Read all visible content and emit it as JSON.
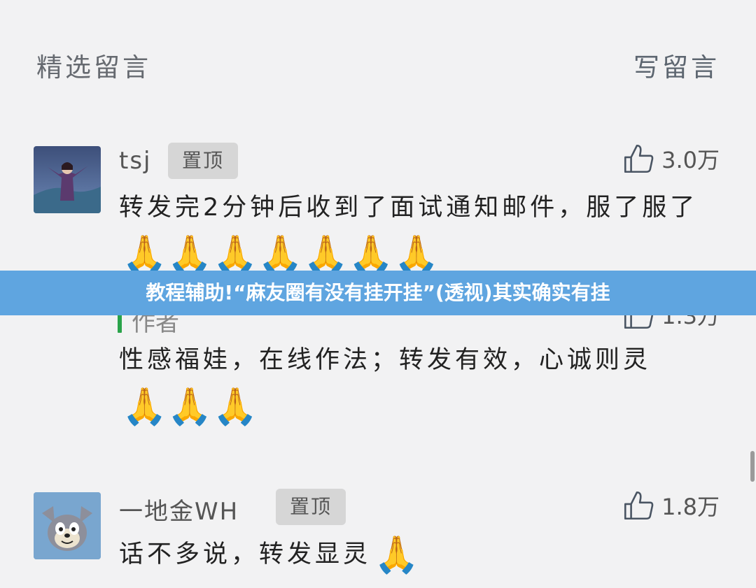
{
  "header": {
    "title": "精选留言",
    "write_label": "写留言"
  },
  "comments": [
    {
      "author": "tsj",
      "pin": "置顶",
      "likes": "3.0万",
      "text": "转发完2分钟后收到了面试通知邮件，服了服了",
      "emoji": "🙏🙏🙏🙏🙏🙏🙏"
    },
    {
      "author": "一地金WH",
      "pin": "置顶",
      "likes": "1.8万",
      "text": "话不多说，转发显灵",
      "emoji": "🙏"
    }
  ],
  "author_reply": {
    "label": "作者",
    "likes": "1.3万",
    "text": "性感福娃，在线作法；转发有效，心诚则灵",
    "emoji": "🙏🙏🙏"
  },
  "banner": {
    "text": "教程辅助!“麻友圈有没有挂开挂”(透视)其实确实有挂"
  },
  "colors": {
    "banner_bg": "#5fa5e0",
    "reply_bar": "#2aa34a",
    "page_bg": "#f2f2f3"
  }
}
